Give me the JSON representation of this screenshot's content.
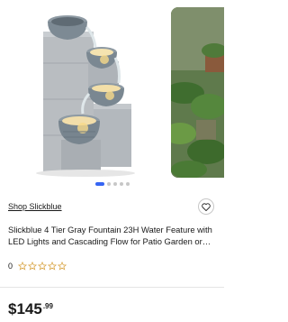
{
  "gallery": {
    "main_image": "4-tier-gray-fountain-photo",
    "side_image": "patio-garden-plants-photo",
    "total_images": 5,
    "active_index": 0
  },
  "shop": {
    "label": "Shop Slickblue"
  },
  "product": {
    "title": "Slickblue 4 Tier Gray Fountain 23H Water Feature with LED Lights and Cascading Flow for Patio Garden or…"
  },
  "rating": {
    "count": "0",
    "stars": 0,
    "max_stars": 5
  },
  "price": {
    "main": "$145",
    "cents": ".99"
  },
  "colors": {
    "accent": "#3665f3",
    "star": "#d9a443"
  },
  "icons": {
    "wishlist": "heart-icon",
    "star": "star-outline-icon"
  }
}
